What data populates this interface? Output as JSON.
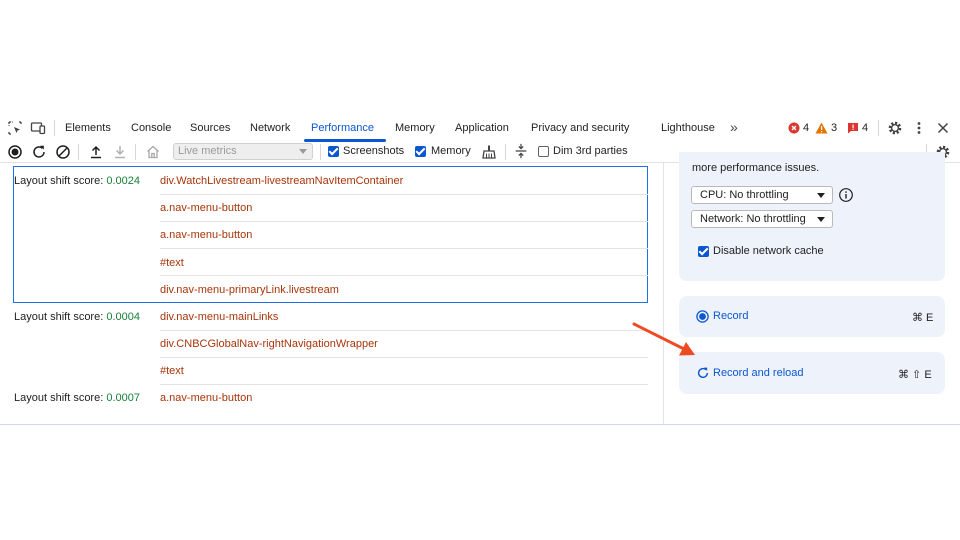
{
  "tabs": {
    "elements": "Elements",
    "console": "Console",
    "sources": "Sources",
    "network": "Network",
    "performance": "Performance",
    "memory": "Memory",
    "application": "Application",
    "privacy": "Privacy and security",
    "lighthouse": "Lighthouse",
    "more": "»"
  },
  "badges": {
    "errors": "4",
    "warnings": "3",
    "issues": "4"
  },
  "toolbar": {
    "live_metrics": "Live metrics",
    "screenshots": "Screenshots",
    "screenshots_checked": true,
    "memory": "Memory",
    "memory_checked": true,
    "dim_3rd_parties": "Dim 3rd parties",
    "dim_checked": false
  },
  "layout_shifts": [
    {
      "label": "Layout shift score:",
      "score": "0.0024",
      "nodes": [
        "div.WatchLivestream-livestreamNavItemContainer",
        "a.nav-menu-button",
        "a.nav-menu-button",
        "#text",
        "div.nav-menu-primaryLink.livestream"
      ]
    },
    {
      "label": "Layout shift score:",
      "score": "0.0004",
      "nodes": [
        "div.nav-menu-mainLinks",
        "div.CNBCGlobalNav-rightNavigationWrapper",
        "#text"
      ]
    },
    {
      "label": "Layout shift score:",
      "score": "0.0007",
      "nodes": [
        "a.nav-menu-button"
      ]
    }
  ],
  "settings": {
    "partial_text": "more performance issues.",
    "cpu": "CPU: No throttling",
    "network": "Network: No throttling",
    "disable_cache": "Disable network cache",
    "disable_cache_checked": true
  },
  "actions": {
    "record": "Record",
    "record_shortcut": "⌘ E",
    "record_reload": "Record and reload",
    "record_reload_shortcut": "⌘ ⇧ E"
  },
  "colors": {
    "accent": "#0b57d0",
    "annotation_arrow": "#f04a23",
    "score": "#188038",
    "node": "#a8350a"
  }
}
